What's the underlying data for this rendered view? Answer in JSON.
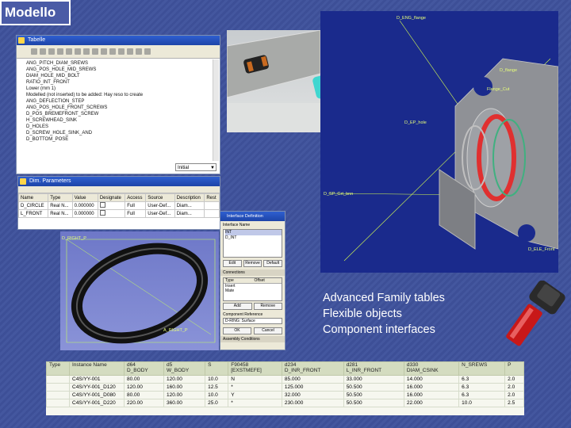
{
  "slide_title": "Modello",
  "captions": [
    "Advanced Family tables",
    "Flexible objects",
    "Component interfaces"
  ],
  "family_window": {
    "title": "Tabelle",
    "tree_items": [
      "ANG_PITCH_DIAM_SREWS",
      "ANG_POS_HOLE_MID_SREWS",
      "DIAM_HOLE_MID_BOLT",
      "",
      "RATIO_INT_FRONT",
      "Lower (mm 1)",
      "Modelled (not inserted) to be added: Hay reso to create",
      "ANG_DEFLECTION_STEP",
      "ANG_POS_HOLE_FRONT_SCREWS",
      "D_POS_BREMEFRONT_SCREW",
      "H_SCREWHEAD_SINK",
      "D_HOLES",
      "D_SCREW_HOLE_SINK_AND",
      "D_BOTTOM_POSE"
    ],
    "dropdown_value": "Initial"
  },
  "params_window": {
    "title": "Dim. Parameters",
    "headers": [
      "Name",
      "Type",
      "Value",
      "Designate",
      "Access",
      "Source",
      "Description",
      "Rest"
    ],
    "rows": [
      [
        "D_CIRCLE",
        "Real N...",
        "0.000000",
        "",
        "Full",
        "User-Def...",
        "Diam...",
        ""
      ],
      [
        "L_FRONT",
        "Real N...",
        "0.000000",
        "",
        "Full",
        "User-Def...",
        "Diam...",
        ""
      ]
    ]
  },
  "interface_dialog": {
    "title": "Interface Definition",
    "name_label": "Interface Name",
    "list_items": [
      "INT",
      "D_INT"
    ],
    "buttons": [
      "Edit",
      "Remove",
      "Default"
    ],
    "section_label": "Connections",
    "col_type": "Type",
    "col_offset": "Offset",
    "conn_rows": [
      "Insert",
      "Mate"
    ],
    "add_label": "Add",
    "remove_label": "Remove",
    "component_ref_label": "Component Reference",
    "surface_label": "D-RING: Surface",
    "ok_label": "OK",
    "cancel_label": "Cancel",
    "bottom_label": "Assembly Conditions"
  },
  "oring_labels": [
    "D_RIGHT_P",
    "A_RIGHT_P"
  ],
  "cad_labels": [
    "D_ENG_flange",
    "D_flange",
    "Flange_Cut",
    "D_EP_hole",
    "D_SP_Grt_bnn",
    "D_ELE_Front"
  ],
  "table": {
    "headers": [
      "Type",
      "Instance Name",
      "d64\nD_BODY",
      "d5\nW_BODY",
      "S",
      "F90458\n[EXSTMEFE]",
      "d234\nD_INR_FRONT",
      "d281\nL_INR_FRONT",
      "d330\nDIAM_CSINK",
      "N_SREWS",
      "P"
    ],
    "rows": [
      [
        "",
        "C4S/YY-001",
        "80.00",
        "120.00",
        "10.0",
        "N",
        "85.000",
        "33.000",
        "14.000",
        "6.3",
        "2.0"
      ],
      [
        "",
        "C4S/YY-001_D120",
        "120.00",
        "160.00",
        "12.5",
        "*",
        "125.000",
        "50.500",
        "16.000",
        "6.3",
        "2.0"
      ],
      [
        "",
        "C4S/YY-001_D080",
        "80.00",
        "120.00",
        "10.0",
        "Y",
        "32.000",
        "50.500",
        "16.000",
        "6.3",
        "2.0"
      ],
      [
        "",
        "C4S/YY-001_D220",
        "220.00",
        "360.00",
        "25.0",
        "*",
        "230.000",
        "50.500",
        "22.000",
        "10.0",
        "2.5"
      ]
    ]
  }
}
